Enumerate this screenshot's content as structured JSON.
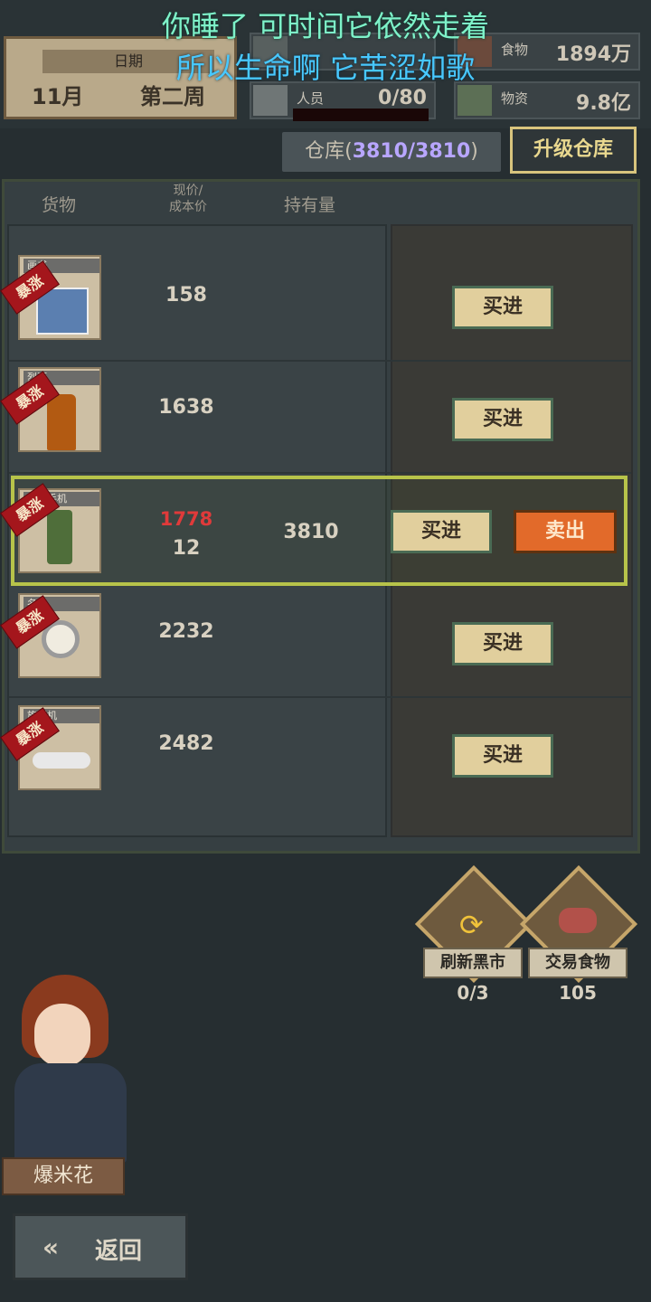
{
  "lyrics": {
    "line1": "你睡了 可时间它依然走着",
    "line2": "所以生命啊 它苦涩如歌"
  },
  "date": {
    "label": "日期",
    "month": "11月",
    "week": "第二周"
  },
  "stats": {
    "food": {
      "label": "食物",
      "value": "1894万"
    },
    "people": {
      "label": "人员",
      "value": "0/80"
    },
    "supplies": {
      "label": "物资",
      "value": "9.8亿"
    }
  },
  "warehouse": {
    "label": "仓库",
    "value": "3810/3810",
    "upgrade": "升级仓库"
  },
  "table": {
    "headers": {
      "goods": "货物",
      "price_line1": "现价/",
      "price_line2": "成本价",
      "holding": "持有量"
    },
    "badge": "暴涨",
    "buy": "买进",
    "sell": "卖出",
    "rows": [
      {
        "tag": "画书",
        "price": "158"
      },
      {
        "tag": "烈酒",
        "price": "1638"
      },
      {
        "tag": "卫星手机",
        "price": "1778",
        "cost": "12",
        "holding": "3810"
      },
      {
        "tag": "名表",
        "price": "2232"
      },
      {
        "tag": "旋翼机",
        "price": "2482"
      }
    ]
  },
  "actions": {
    "refresh": {
      "label": "刷新黑市",
      "count": "0/3"
    },
    "food": {
      "label": "交易食物",
      "count": "105"
    }
  },
  "character": {
    "name": "爆米花"
  },
  "back": {
    "label": "返回"
  },
  "colors": {
    "accent": "#e9d88f",
    "rise_badge": "#a4161c",
    "price_up": "#e03a3a",
    "sell": "#e26a2a"
  }
}
